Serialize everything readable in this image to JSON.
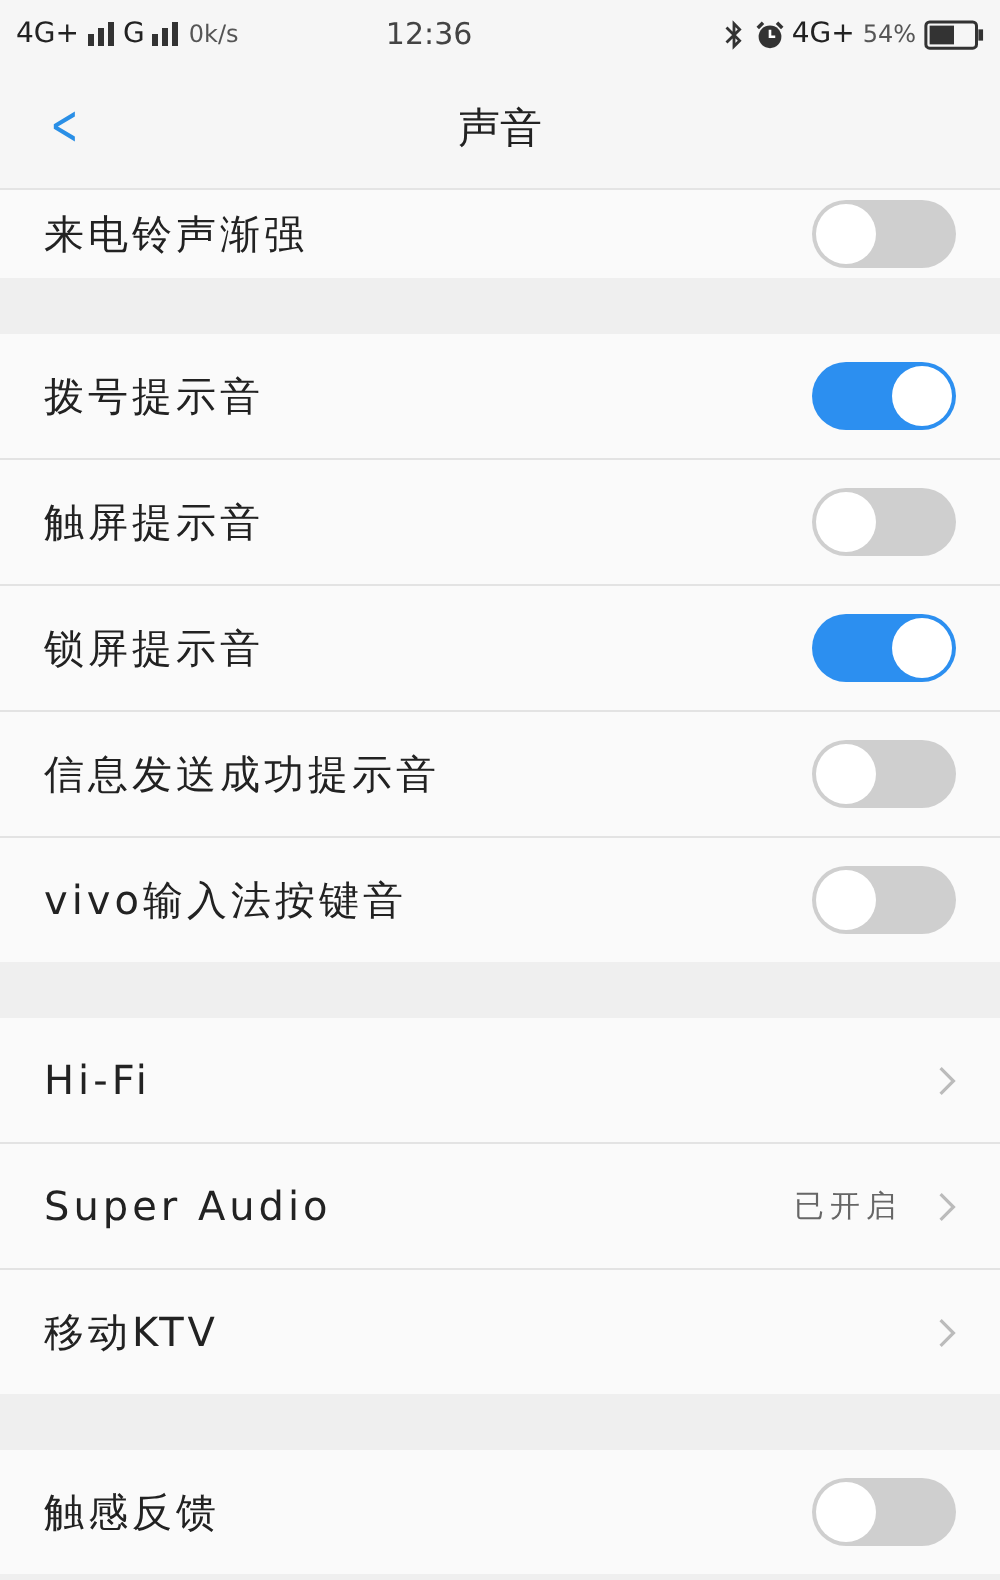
{
  "status_bar": {
    "network_1": "4G+",
    "network_2": "G",
    "speed": "0k/s",
    "time": "12:36",
    "network_3": "4G+",
    "battery": "54%"
  },
  "header": {
    "back": "<",
    "title": "声音"
  },
  "sections": [
    {
      "items": [
        {
          "kind": "toggle",
          "label": "来电铃声渐强",
          "on": false
        }
      ]
    },
    {
      "items": [
        {
          "kind": "toggle",
          "label": "拨号提示音",
          "on": true
        },
        {
          "kind": "toggle",
          "label": "触屏提示音",
          "on": false
        },
        {
          "kind": "toggle",
          "label": "锁屏提示音",
          "on": true
        },
        {
          "kind": "toggle",
          "label": "信息发送成功提示音",
          "on": false
        },
        {
          "kind": "toggle",
          "label": "vivo输入法按键音",
          "on": false
        }
      ]
    },
    {
      "items": [
        {
          "kind": "link",
          "label": "Hi-Fi"
        },
        {
          "kind": "link",
          "label": "Super Audio",
          "value": "已开启"
        },
        {
          "kind": "link",
          "label": "移动KTV"
        }
      ]
    },
    {
      "items": [
        {
          "kind": "toggle",
          "label": "触感反馈",
          "on": false
        }
      ]
    }
  ]
}
